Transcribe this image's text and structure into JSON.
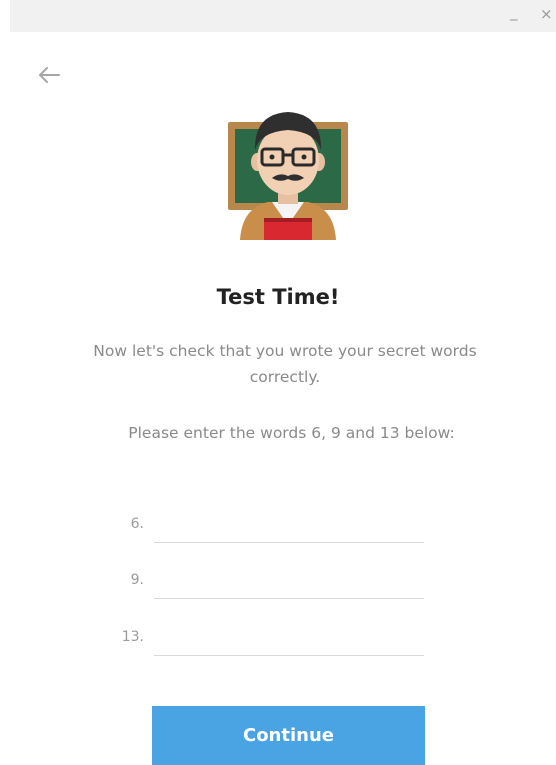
{
  "window": {
    "minimize_glyph": "_",
    "close_glyph": "×"
  },
  "icons": {
    "back": "back-arrow-icon",
    "avatar": "teacher-emoji-icon"
  },
  "heading": "Test Time!",
  "description": "Now let's check that you wrote your secret words correctly.",
  "prompt": "Please enter the words 6, 9 and 13 below:",
  "words": [
    {
      "label": "6.",
      "value": ""
    },
    {
      "label": "9.",
      "value": ""
    },
    {
      "label": "13.",
      "value": ""
    }
  ],
  "continue_label": "Continue",
  "colors": {
    "accent": "#4aa4e3",
    "title_text": "#222222",
    "muted_text": "#8a8a8a"
  }
}
